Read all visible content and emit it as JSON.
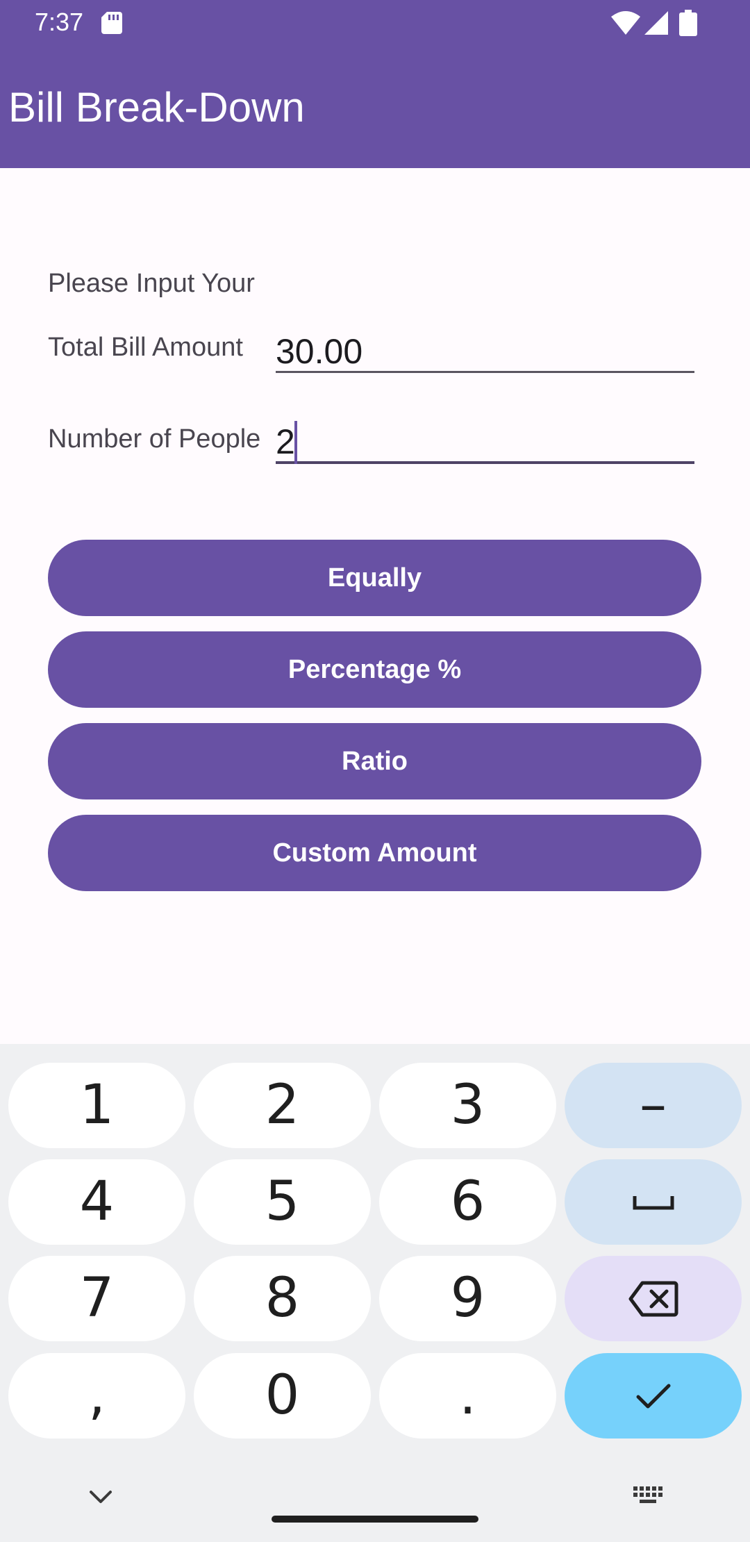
{
  "status_bar": {
    "time": "7:37"
  },
  "app_bar": {
    "title": "Bill Break-Down"
  },
  "form": {
    "intro": "Please Input Your",
    "total_label": "Total Bill Amount",
    "total_value": "30.00",
    "people_label": "Number of People",
    "people_value": "2"
  },
  "buttons": {
    "equally": "Equally",
    "percentage": "Percentage %",
    "ratio": "Ratio",
    "custom": "Custom Amount"
  },
  "keyboard": {
    "k1": "1",
    "k2": "2",
    "k3": "3",
    "k4": "4",
    "k5": "5",
    "k6": "6",
    "k7": "7",
    "k8": "8",
    "k9": "9",
    "comma": ",",
    "k0": "0",
    "period": ".",
    "minus": "–",
    "icons": [
      "space-icon",
      "backspace-icon",
      "checkmark-icon",
      "chevron-down-icon",
      "keyboard-icon"
    ],
    "colors": {
      "function_key": "#d3e3f3",
      "backspace_key": "#e4def7",
      "enter_key": "#76d1fb"
    }
  },
  "colors": {
    "primary": "#6851a4",
    "background": "#fffbfe"
  }
}
